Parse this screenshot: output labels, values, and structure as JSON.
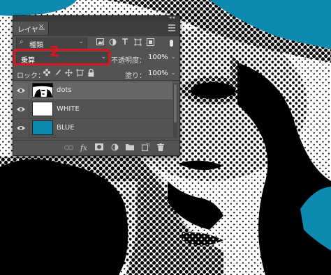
{
  "panel": {
    "tab_label": "レイヤー",
    "tab_close": "×",
    "topbar_arrows": "◂◂"
  },
  "filter": {
    "search_glyph": "⌕",
    "kind_label": "種類",
    "chevron": "⌄",
    "icons": [
      "image-filter-icon",
      "adjustment-filter-icon",
      "type-filter-icon",
      "shape-filter-icon",
      "smart-object-filter-icon"
    ]
  },
  "blend": {
    "mode_value": "乗算",
    "chevron": "⌄",
    "callout_number": "2",
    "highlight_color": "#e0141e"
  },
  "opacity": {
    "label": "不透明度：",
    "value": "100%",
    "chevron": "⌄"
  },
  "lock": {
    "label": "ロック：",
    "icons": [
      "lock-transparent-pixels-icon",
      "lock-image-pixels-icon",
      "lock-position-icon",
      "lock-artboard-icon",
      "lock-all-icon"
    ]
  },
  "fill": {
    "label": "塗り：",
    "value": "100%",
    "chevron": "⌄"
  },
  "layers": [
    {
      "name": "dots",
      "selected": true,
      "visible": true,
      "thumbnail": "halftone"
    },
    {
      "name": "WHITE",
      "selected": false,
      "visible": true,
      "thumbnail_color": "#ffffff"
    },
    {
      "name": "BLUE",
      "selected": false,
      "visible": true,
      "thumbnail_color": "#0d8ab0"
    }
  ],
  "bottom_bar": {
    "icons": [
      "link-layers-icon",
      "fx-icon",
      "add-mask-icon",
      "adjustment-layer-icon",
      "new-group-icon",
      "new-layer-icon",
      "delete-layer-icon"
    ],
    "fx_label": "fx"
  },
  "colors": {
    "blue_bg": "#0d8ab0",
    "panel_bg": "#535353",
    "selected_row": "#676767"
  }
}
